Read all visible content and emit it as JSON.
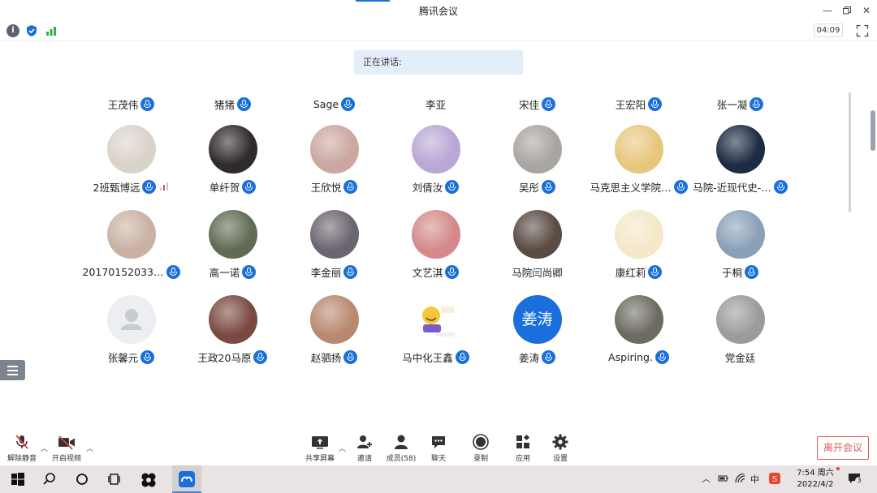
{
  "window": {
    "title": "腾讯会议",
    "timer": "04:09"
  },
  "speaking_label": "正在讲话:",
  "top_row": [
    {
      "name": "王茂伟",
      "mic": true
    },
    {
      "name": "猪猪",
      "mic": true
    },
    {
      "name": "Sage",
      "mic": true
    },
    {
      "name": "李亚",
      "mic": false
    },
    {
      "name": "宋佳",
      "mic": true
    },
    {
      "name": "王宏阳",
      "mic": true
    },
    {
      "name": "张一凝",
      "mic": true
    }
  ],
  "rows": [
    [
      {
        "name": "2班甄博远",
        "mic": true,
        "signal": true,
        "avatar": "white-dog-photo",
        "bg": "#d9d2c8"
      },
      {
        "name": "单纤贺",
        "mic": true,
        "avatar": "portrait-photo",
        "bg": "#2f2a2c"
      },
      {
        "name": "王欣悦",
        "mic": true,
        "avatar": "anime-girl-avatar",
        "bg": "#caa7a0"
      },
      {
        "name": "刘倩汝",
        "mic": true,
        "avatar": "purple-texture",
        "bg": "#b9a7d6"
      },
      {
        "name": "吴彤",
        "mic": true,
        "avatar": "beach-shell-photo",
        "bg": "#a9a5a0"
      },
      {
        "name": "马克思主义学院…",
        "mic": true,
        "avatar": "cartoon-girl-avatar",
        "bg": "#e7c77d"
      },
      {
        "name": "马院-近现代史-…",
        "mic": true,
        "avatar": "night-sky-photo",
        "bg": "#1d2b44"
      }
    ],
    [
      {
        "name": "201701520339…",
        "mic": true,
        "avatar": "teddy-bear-photo",
        "bg": "#c9b2a3"
      },
      {
        "name": "高一诺",
        "mic": true,
        "avatar": "girl-outdoor-photo",
        "bg": "#5f6b52"
      },
      {
        "name": "李金丽",
        "mic": true,
        "avatar": "person-sitting-photo",
        "bg": "#6b6570"
      },
      {
        "name": "文艺淇",
        "mic": true,
        "avatar": "red-hat-girl-photo",
        "bg": "#d48a8a"
      },
      {
        "name": "马院闫尚卿",
        "mic": false,
        "avatar": "couple-photo",
        "bg": "#5a4b43"
      },
      {
        "name": "康红莉",
        "mic": true,
        "avatar": "duck-cartoon-avatar",
        "bg": "#f4e8c8"
      },
      {
        "name": "于桐",
        "mic": true,
        "avatar": "anime-boys-avatar",
        "bg": "#8aa0b8"
      }
    ],
    [
      {
        "name": "张馨元",
        "mic": true,
        "avatar": "default-user-avatar",
        "bg": "#eceef1"
      },
      {
        "name": "王政20马原",
        "mic": true,
        "avatar": "temple-photo",
        "bg": "#7a4a42"
      },
      {
        "name": "赵驷扬",
        "mic": true,
        "avatar": "girl-closeup-photo",
        "bg": "#b88970"
      },
      {
        "name": "马中化王鑫",
        "mic": true,
        "avatar": "emoji-sticker",
        "bg": "#ffffff"
      },
      {
        "name": "姜涛",
        "mic": true,
        "avatar": "text-avatar",
        "avatar_text": "姜涛",
        "bg": "#1a6fdc"
      },
      {
        "name": "Aspiring.",
        "mic": true,
        "avatar": "pikachu-photo",
        "bg": "#6d6a62"
      },
      {
        "name": "党金廷",
        "mic": false,
        "avatar": "bw-portrait-photo",
        "bg": "#9b9b9b"
      }
    ]
  ],
  "toolbar": {
    "unmute": "解除静音",
    "start_video": "开启视频",
    "share_screen": "共享屏幕",
    "invite": "邀请",
    "members": "成员(58)",
    "chat": "聊天",
    "record": "录制",
    "apps": "应用",
    "settings": "设置",
    "leave": "离开会议"
  },
  "taskbar": {
    "time": "7:54 周六",
    "date": "2022/4/2",
    "ime": "中",
    "notifications": "3"
  },
  "colors": {
    "accent": "#1a6fdc",
    "leave": "#e15a5a"
  }
}
